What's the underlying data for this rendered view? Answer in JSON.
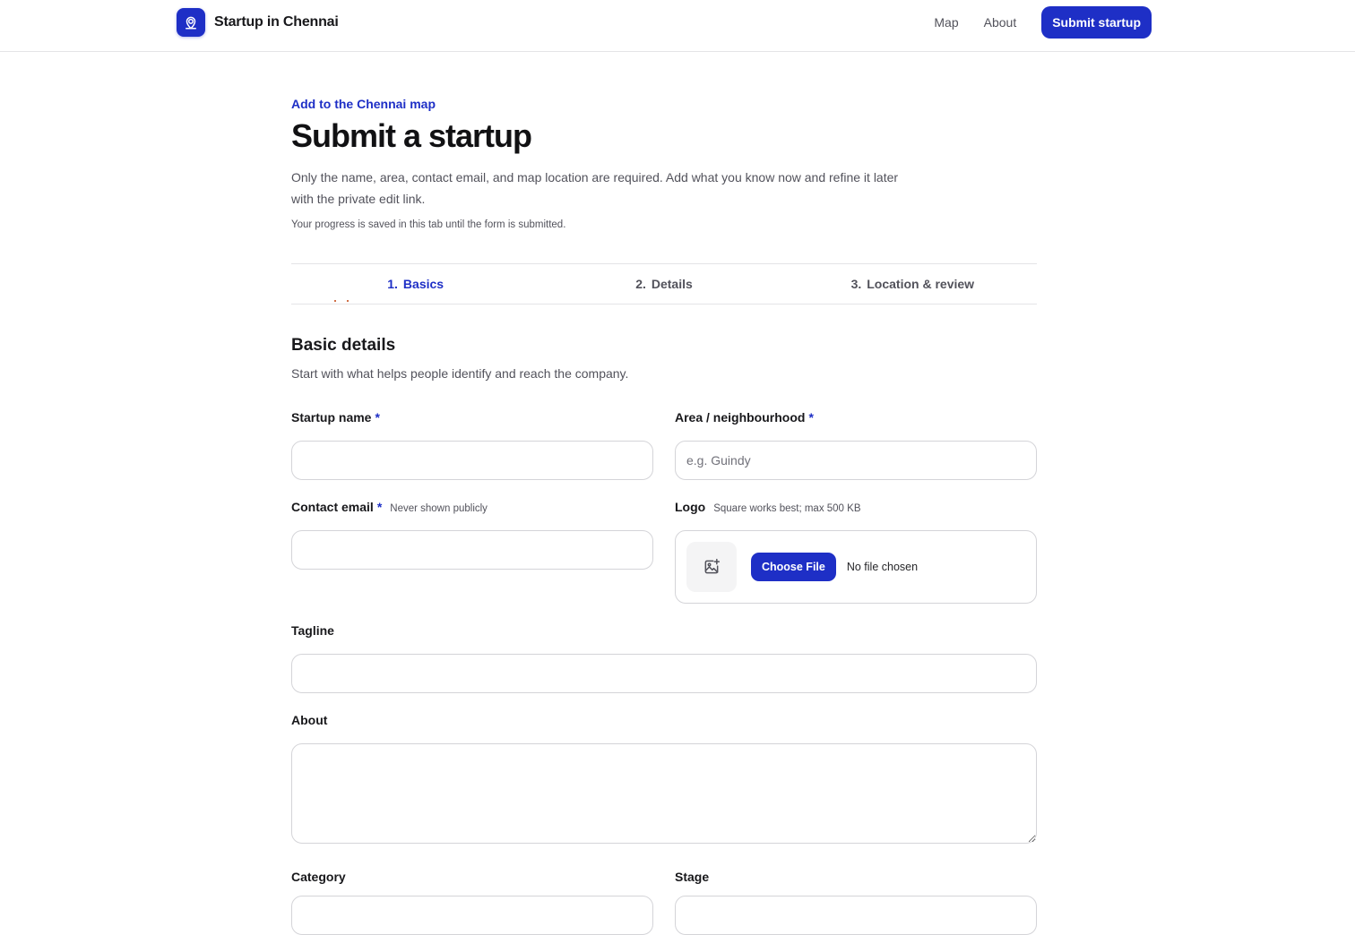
{
  "header": {
    "brand_name": "Startup in Chennai",
    "brand_icon": "map-pin-icon",
    "nav": [
      {
        "label": "Map"
      },
      {
        "label": "About"
      }
    ],
    "cta_label": "Submit startup",
    "accent_color": "#1e2fc6"
  },
  "page": {
    "eyebrow": "Add to the Chennai map",
    "title": "Submit a startup",
    "intro": "Only the name, area, contact email, and map location are required. Add what you know now and refine it later with the private edit link.",
    "progress_note": "Your progress is saved in this tab until the form is submitted."
  },
  "steps": [
    {
      "num": "1.",
      "label": "Basics",
      "active": true
    },
    {
      "num": "2.",
      "label": "Details",
      "active": false
    },
    {
      "num": "3.",
      "label": "Location & review",
      "active": false
    }
  ],
  "section": {
    "title": "Basic details",
    "subtitle": "Start with what helps people identify and reach the company."
  },
  "fields": {
    "startup_name": {
      "label": "Startup name",
      "required": "*",
      "value": "",
      "placeholder": ""
    },
    "area": {
      "label": "Area / neighbourhood",
      "required": "*",
      "value": "",
      "placeholder": "e.g. Guindy"
    },
    "contact_email": {
      "label": "Contact email",
      "required": "*",
      "hint": "Never shown publicly",
      "value": "",
      "placeholder": ""
    },
    "logo": {
      "label": "Logo",
      "hint": "Square works best; max 500 KB",
      "button_label": "Choose File",
      "status": "No file chosen",
      "icon": "image-add-icon"
    },
    "tagline": {
      "label": "Tagline",
      "value": ""
    },
    "about": {
      "label": "About",
      "value": ""
    },
    "category": {
      "label": "Category"
    },
    "stage": {
      "label": "Stage"
    }
  }
}
